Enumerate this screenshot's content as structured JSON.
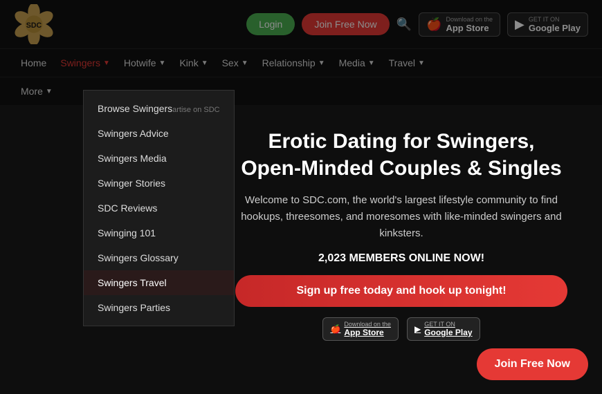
{
  "header": {
    "logo_alt": "SDC Logo",
    "btn_login": "Login",
    "btn_join": "Join Free Now",
    "search_icon": "🔍",
    "appstore_label": "App Store",
    "appstore_sublabel": "Download on the",
    "googleplay_label": "Google Play",
    "googleplay_sublabel": "GET IT ON"
  },
  "nav": {
    "items": [
      {
        "label": "Home",
        "active": false,
        "has_dropdown": false
      },
      {
        "label": "Swingers",
        "active": true,
        "has_dropdown": true
      },
      {
        "label": "Hotwife",
        "active": false,
        "has_dropdown": true
      },
      {
        "label": "Kink",
        "active": false,
        "has_dropdown": true
      },
      {
        "label": "Sex",
        "active": false,
        "has_dropdown": true
      },
      {
        "label": "Relationship",
        "active": false,
        "has_dropdown": true
      },
      {
        "label": "Media",
        "active": false,
        "has_dropdown": true
      },
      {
        "label": "Travel",
        "active": false,
        "has_dropdown": true
      }
    ],
    "more_label": "More"
  },
  "dropdown": {
    "items": [
      {
        "label": "Browse Swingers",
        "highlighted": false
      },
      {
        "label": "Swingers Advice",
        "highlighted": false
      },
      {
        "label": "Swingers Media",
        "highlighted": false
      },
      {
        "label": "Swinger Stories",
        "highlighted": false
      },
      {
        "label": "SDC Reviews",
        "highlighted": false
      },
      {
        "label": "Swinging 101",
        "highlighted": false
      },
      {
        "label": "Swingers Glossary",
        "highlighted": false
      },
      {
        "label": "Swingers Travel",
        "highlighted": true
      },
      {
        "label": "Swingers Parties",
        "highlighted": false
      }
    ]
  },
  "main": {
    "title": "Erotic Dating for Swingers, Open-Minded Couples & Singles",
    "subtitle": "Welcome to SDC.com, the world's largest lifestyle community to find hookups, threesomes, and moresomes with like-minded swingers and kinksters.",
    "members_online": "2,023 MEMBERS ONLINE NOW!",
    "cta_text": "Sign up free today and hook up tonight!",
    "float_join": "Join Free Now",
    "appstore_badge": "App Store",
    "appstore_sub": "Download on the",
    "googleplay_badge": "Google Play",
    "googleplay_sub": "GET IT ON"
  }
}
